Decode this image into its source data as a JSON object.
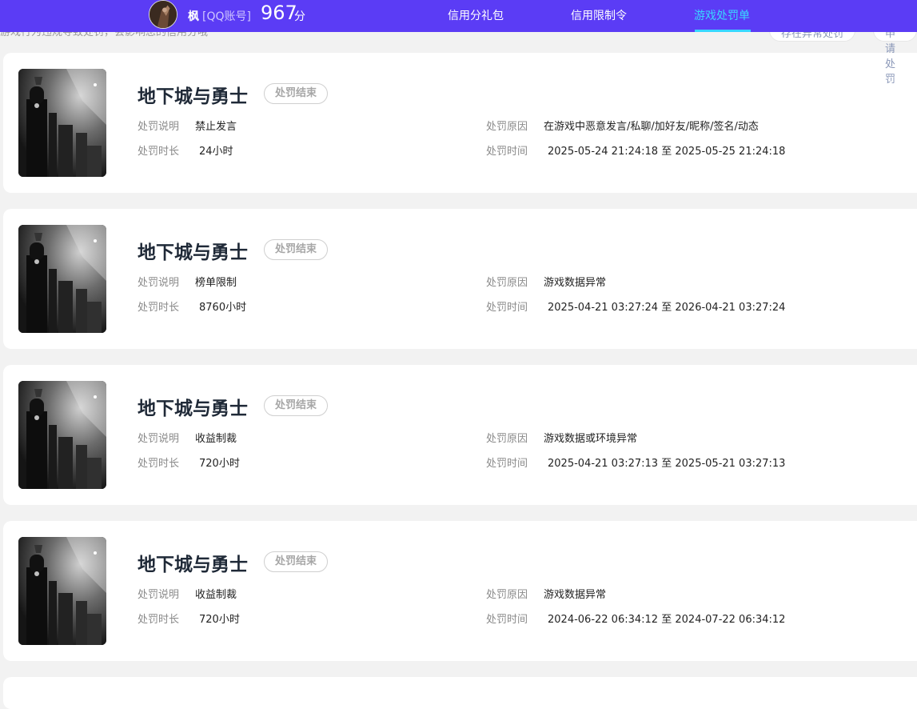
{
  "header": {
    "nickname": "枫",
    "account_type": "[QQ账号]",
    "score": "967",
    "score_unit": "分",
    "tabs": [
      {
        "label": "信用分礼包",
        "active": false
      },
      {
        "label": "信用限制令",
        "active": false
      },
      {
        "label": "游戏处罚单",
        "active": true
      }
    ]
  },
  "peek": {
    "notice": "游戏行为违规导致处罚，会影响您的信用分哦",
    "button_a": "存在异常处罚",
    "button_b": "申请处罚"
  },
  "labels": {
    "desc": "处罚说明",
    "duration": "处罚时长",
    "reason": "处罚原因",
    "time": "处罚时间",
    "to": "至"
  },
  "records": [
    {
      "game": "地下城与勇士",
      "status": "处罚结束",
      "desc": "禁止发言",
      "duration": "24小时",
      "reason": "在游戏中恶意发言/私聊/加好友/昵称/签名/动态",
      "start": "2025-05-24 21:24:18",
      "end": "2025-05-25 21:24:18"
    },
    {
      "game": "地下城与勇士",
      "status": "处罚结束",
      "desc": "榜单限制",
      "duration": "8760小时",
      "reason": "游戏数据异常",
      "start": "2025-04-21 03:27:24",
      "end": "2026-04-21 03:27:24"
    },
    {
      "game": "地下城与勇士",
      "status": "处罚结束",
      "desc": "收益制裁",
      "duration": "720小时",
      "reason": "游戏数据或环境异常",
      "start": "2025-04-21 03:27:13",
      "end": "2025-05-21 03:27:13"
    },
    {
      "game": "地下城与勇士",
      "status": "处罚结束",
      "desc": "收益制裁",
      "duration": "720小时",
      "reason": "游戏数据异常",
      "start": "2024-06-22 06:34:12",
      "end": "2024-07-22 06:34:12"
    }
  ]
}
